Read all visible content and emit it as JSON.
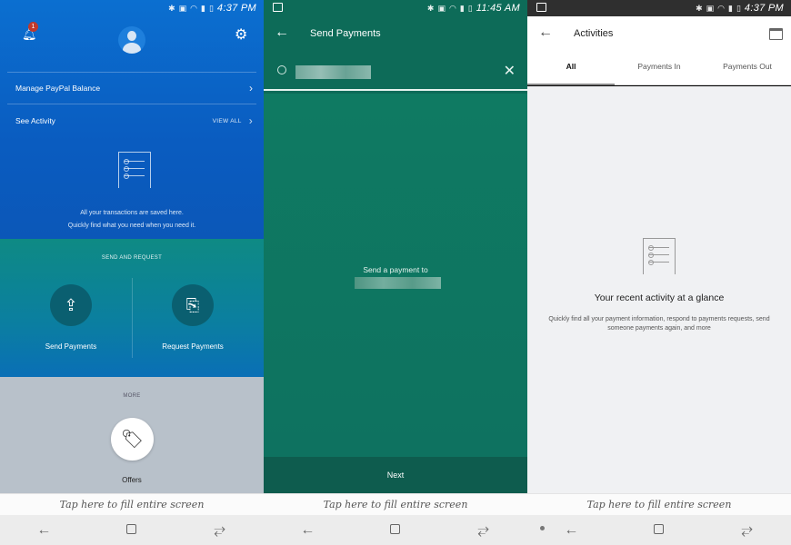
{
  "status_bar": {
    "time_1": "4:37 PM",
    "time_2": "11:45 AM",
    "time_3": "4:37 PM",
    "icons": [
      "bluetooth-icon",
      "nfc-icon",
      "volte-icon",
      "wifi-icon",
      "signal-icon",
      "battery-icon"
    ]
  },
  "hint_text": "Tap here to fill entire screen",
  "panel1": {
    "notification_count": "1",
    "manage_balance_label": "Manage PayPal Balance",
    "see_activity_label": "See Activity",
    "view_all_label": "VIEW ALL",
    "empty_line_1": "All your transactions are saved here.",
    "empty_line_2": "Quickly find what you need when you need it.",
    "send_request_title": "SEND AND REQUEST",
    "send_payments_label": "Send Payments",
    "request_payments_label": "Request Payments",
    "more_title": "MORE",
    "offers_label": "Offers",
    "colors": {
      "blue": "#0b62c6",
      "teal": "#0e8a84",
      "gray": "#b8c1ca"
    }
  },
  "panel2": {
    "title": "Send Payments",
    "prompt": "Send a payment to",
    "next_label": "Next",
    "colors": {
      "green": "#0d6b58",
      "next_bar": "#0e5c4e"
    }
  },
  "panel3": {
    "title": "Activities",
    "tabs": [
      {
        "label": "All",
        "active": true
      },
      {
        "label": "Payments In",
        "active": false
      },
      {
        "label": "Payments Out",
        "active": false
      }
    ],
    "headline": "Your recent activity at a glance",
    "description": "Quickly find all your payment information, respond to payments requests, send someone payments again, and more"
  }
}
